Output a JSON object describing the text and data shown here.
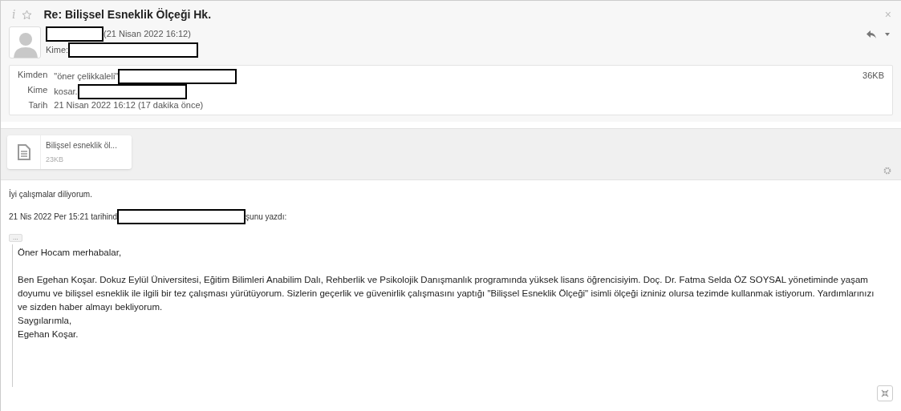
{
  "header": {
    "info_icon": "i",
    "starred": false,
    "subject": "Re: Bilişsel Esneklik Ölçeği Hk.",
    "close": "×",
    "date": "(21 Nisan 2022 16:12)",
    "to_label": "Kime:"
  },
  "details": {
    "fields": [
      {
        "label": "Kimden",
        "value": "\"öner çelikkaleli\"",
        "redacted": true
      },
      {
        "label": "Kime",
        "value": "kosar.",
        "redacted": true
      },
      {
        "label": "Tarih",
        "value": "21 Nisan 2022 16:12 (17 dakika önce)",
        "redacted": false
      }
    ],
    "size": "36KB"
  },
  "attachments": [
    {
      "name": "Bilişsel esneklik öl...",
      "size": "23KB"
    }
  ],
  "body": {
    "greeting": "İyi çalışmalar diliyorum.",
    "quote_intro_start": "21 Nis 2022 Per 15:21 tarihind",
    "quote_intro_end": "şunu yazdı:",
    "expander": "...",
    "quoted": {
      "salutation": "Öner Hocam merhabalar,",
      "lines": [
        "Ben Egehan Koşar. Dokuz Eylül Üniversitesi, Eğitim Bilimleri Anabilim Dalı, Rehberlik ve Psikolojik Danışmanlık programında yüksek lisans öğrencisiyim. Doç. Dr. Fatma Selda ÖZ SOYSAL yönetiminde yaşam doyumu ve bilişsel esneklik ile ilgili bir tez çalışması yürütüyorum. Sizlerin geçerlik ve güvenirlik çalışmasını yaptığı \"Bilişsel Esneklik Ölçeği\" isimli ölçeği izniniz olursa tezimde kullanmak istiyorum. Yardımlarınızı ve sizden haber almayı bekliyorum.",
        "Saygılarımla,",
        "Egehan Koşar."
      ]
    }
  }
}
